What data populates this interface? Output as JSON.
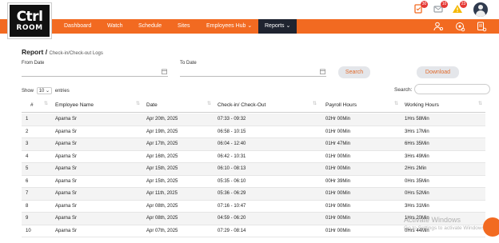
{
  "logo": {
    "line1": "Ctrl",
    "line2": "ROOM"
  },
  "top_icons": [
    {
      "name": "tasks-icon",
      "badge": "30",
      "badge_color": "#e53935"
    },
    {
      "name": "mail-icon",
      "badge": "10",
      "badge_color": "#e53935"
    },
    {
      "name": "alert-icon",
      "badge": "23",
      "badge_color": "#e53935"
    }
  ],
  "nav": {
    "items": [
      "Dashboard",
      "Watch",
      "Schedule",
      "Sites",
      "Employees Hub ⌄",
      "Reports ⌄"
    ],
    "active": "Reports",
    "accent": "#f26a21"
  },
  "page": {
    "title": "Report /",
    "subtitle": "Check-in/Check-out Logs",
    "from_label": "From Date",
    "to_label": "To Date",
    "search_button": "Search",
    "download_button": "Download",
    "show_prefix": "Show",
    "show_value": "10 ⌄",
    "show_suffix": "entries",
    "search_label": "Search:"
  },
  "table": {
    "headers": [
      "#",
      "Employee Name",
      "Date",
      "Check-in/ Check-Out",
      "Payroll Hours",
      "Working Hours"
    ],
    "rows": [
      [
        "1",
        "Aparna Sr",
        "Apr 20th, 2025",
        "07:33 - 09:32",
        "02Hr 00Min",
        "1Hrs 58Min"
      ],
      [
        "2",
        "Aparna Sr",
        "Apr 19th, 2025",
        "06:58 - 10:15",
        "01Hr 00Min",
        "3Hrs 17Min"
      ],
      [
        "3",
        "Aparna Sr",
        "Apr 17th, 2025",
        "06:04 - 12:40",
        "01Hr 47Min",
        "6Hrs 35Min"
      ],
      [
        "4",
        "Aparna Sr",
        "Apr 16th, 2025",
        "06:42 - 10:31",
        "01Hr 00Min",
        "3Hrs 49Min"
      ],
      [
        "5",
        "Aparna Sr",
        "Apr 15th, 2025",
        "06:10 - 08:13",
        "01Hr 00Min",
        "2Hrs 2Min"
      ],
      [
        "6",
        "Aparna Sr",
        "Apr 15th, 2025",
        "05:35 - 06:10",
        "00Hr 39Min",
        "0Hrs 35Min"
      ],
      [
        "7",
        "Aparna Sr",
        "Apr 11th, 2025",
        "05:36 - 06:29",
        "01Hr 00Min",
        "0Hrs 52Min"
      ],
      [
        "8",
        "Aparna Sr",
        "Apr 08th, 2025",
        "07:16 - 10:47",
        "01Hr 00Min",
        "3Hrs 31Min"
      ],
      [
        "9",
        "Aparna Sr",
        "Apr 08th, 2025",
        "04:59 - 06:20",
        "01Hr 00Min",
        "1Hrs 20Min"
      ],
      [
        "10",
        "Aparna Sr",
        "Apr 07th, 2025",
        "07:29 - 08:14",
        "01Hr 00Min",
        "0Hrs 44Min"
      ]
    ]
  },
  "watermark": {
    "line1": "Activate Windows",
    "line2": "Go to Settings to activate Windows."
  }
}
